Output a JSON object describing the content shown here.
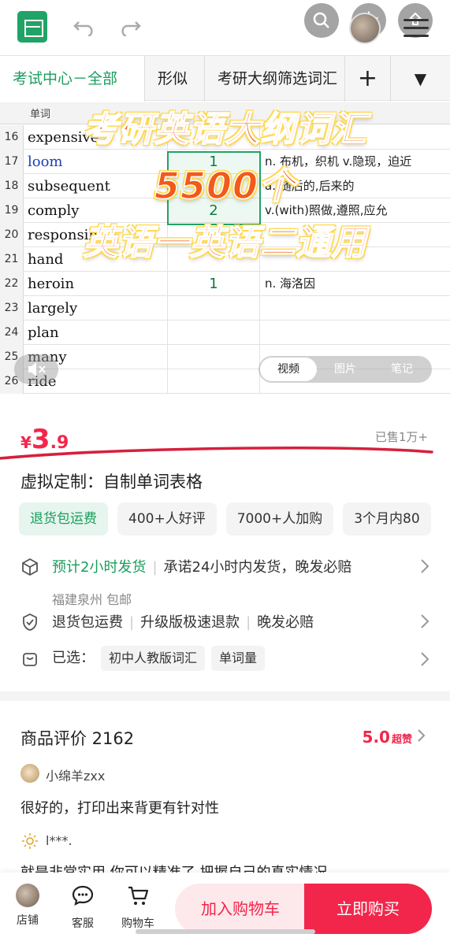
{
  "spreadsheet": {
    "tabs": [
      "考试中心－全部",
      "形似",
      "考研大纲筛选词汇",
      "+",
      "▼"
    ],
    "column_header": "单词",
    "rows": [
      {
        "num": "16",
        "word": "expensive",
        "count": "",
        "meaning": ""
      },
      {
        "num": "17",
        "word": "loom",
        "count": "1",
        "meaning": "n. 布机，织机 v.隐现，迫近"
      },
      {
        "num": "18",
        "word": "subsequent",
        "count": "",
        "meaning": "a. 随后的,后来的"
      },
      {
        "num": "19",
        "word": "comply",
        "count": "2",
        "meaning": "v.(with)照做,遵照,应允"
      },
      {
        "num": "20",
        "word": "responsible",
        "count": "",
        "meaning": ""
      },
      {
        "num": "21",
        "word": "hand",
        "count": "",
        "meaning": ""
      },
      {
        "num": "22",
        "word": "heroin",
        "count": "1",
        "meaning": "n. 海洛因"
      },
      {
        "num": "23",
        "word": "largely",
        "count": "",
        "meaning": ""
      },
      {
        "num": "24",
        "word": "plan",
        "count": "",
        "meaning": ""
      },
      {
        "num": "25",
        "word": "many",
        "count": "",
        "meaning": ""
      },
      {
        "num": "26",
        "word": "ride",
        "count": "",
        "meaning": ""
      }
    ]
  },
  "overlay": {
    "line1": "考研英语大纲词汇",
    "line2": "5500个",
    "line3": "英语一英语二通用"
  },
  "media_toggle": [
    "视频",
    "图片",
    "笔记"
  ],
  "price": {
    "currency": "¥",
    "integer": "3",
    "decimal": ".9",
    "sold": "已售1万+"
  },
  "product": {
    "title": "虚拟定制：自制单词表格",
    "tags": [
      "退货包运费",
      "400+人好评",
      "7000+人加购",
      "3个月内80"
    ]
  },
  "shipping": {
    "estimate": "预计2小时发货",
    "promise": "承诺24小时内发货，晚发必赔",
    "origin": "福建泉州 包邮"
  },
  "service": {
    "items": [
      "退货包运费",
      "升级版极速退款",
      "晚发必赔"
    ]
  },
  "selected": {
    "label": "已选：",
    "options": [
      "初中人教版词汇",
      "单词量"
    ]
  },
  "reviews": {
    "title": "商品评价 2162",
    "score": "5.0",
    "score_label": "超赞",
    "items": [
      {
        "user": "小绵羊zxx",
        "text": "很好的，打印出来背更有针对性"
      },
      {
        "user": "l***.",
        "text": "就是非常实用 你可以精准了 把握自己的真实情况"
      }
    ]
  },
  "bottom_bar": {
    "shop": "店铺",
    "service": "客服",
    "cart": "购物车",
    "add_to_cart": "加入购物车",
    "buy_now": "立即购买"
  },
  "colors": {
    "accent_red": "#f2264b",
    "green": "#1a9d5c",
    "overlay_orange": "#f25a1b"
  }
}
